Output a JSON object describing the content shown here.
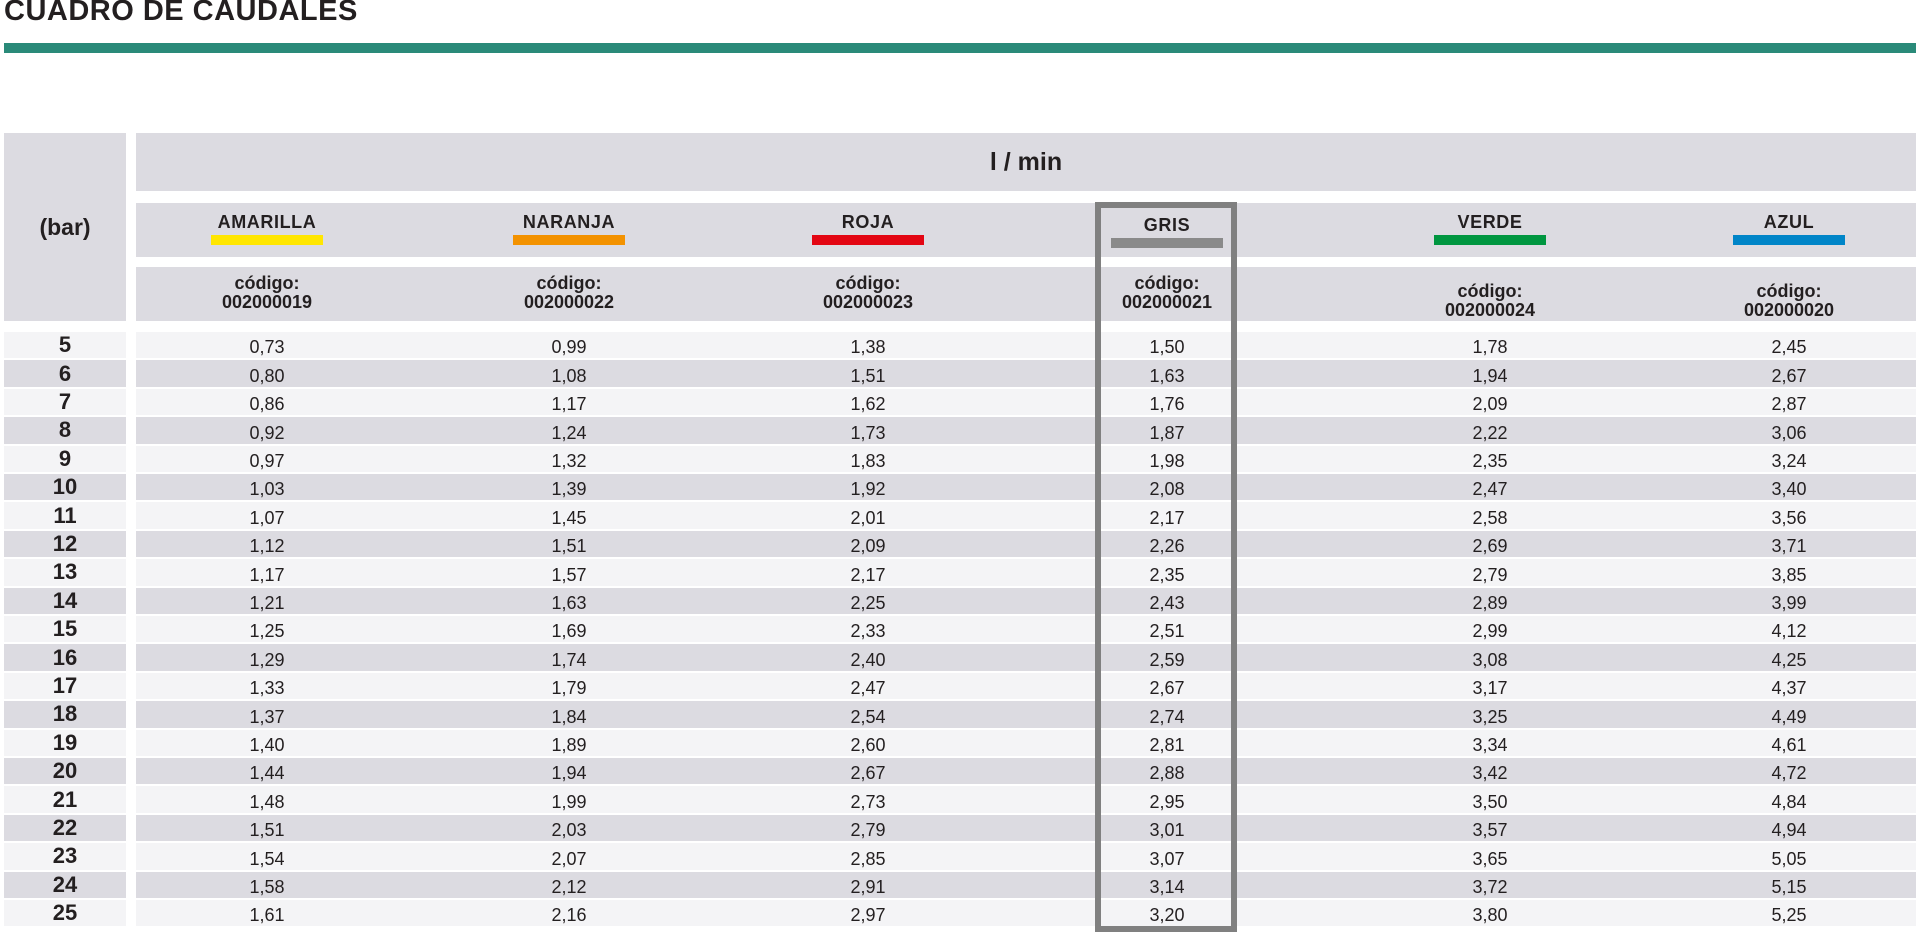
{
  "page": {
    "title": "CUADRO DE CAUDALES",
    "accent_color": "#2a8a79"
  },
  "table": {
    "pressure_header": "(bar)",
    "flow_header": "l / min",
    "highlighted_column": "GRIS",
    "columns": [
      {
        "name": "AMARILLA",
        "code_label": "código:",
        "code": "002000019",
        "color": "#ffe600"
      },
      {
        "name": "NARANJA",
        "code_label": "código:",
        "code": "002000022",
        "color": "#f39200"
      },
      {
        "name": "ROJA",
        "code_label": "código:",
        "code": "002000023",
        "color": "#e30613"
      },
      {
        "name": "GRIS",
        "code_label": "código:",
        "code": "002000021",
        "color": "#8a8a8a"
      },
      {
        "name": "VERDE",
        "code_label": "código:",
        "code": "002000024",
        "color": "#009640"
      },
      {
        "name": "AZUL",
        "code_label": "código:",
        "code": "002000020",
        "color": "#0085c8"
      }
    ],
    "rows": [
      {
        "bar": "5",
        "values": [
          "0,73",
          "0,99",
          "1,38",
          "1,50",
          "1,78",
          "2,45"
        ]
      },
      {
        "bar": "6",
        "values": [
          "0,80",
          "1,08",
          "1,51",
          "1,63",
          "1,94",
          "2,67"
        ]
      },
      {
        "bar": "7",
        "values": [
          "0,86",
          "1,17",
          "1,62",
          "1,76",
          "2,09",
          "2,87"
        ]
      },
      {
        "bar": "8",
        "values": [
          "0,92",
          "1,24",
          "1,73",
          "1,87",
          "2,22",
          "3,06"
        ]
      },
      {
        "bar": "9",
        "values": [
          "0,97",
          "1,32",
          "1,83",
          "1,98",
          "2,35",
          "3,24"
        ]
      },
      {
        "bar": "10",
        "values": [
          "1,03",
          "1,39",
          "1,92",
          "2,08",
          "2,47",
          "3,40"
        ]
      },
      {
        "bar": "11",
        "values": [
          "1,07",
          "1,45",
          "2,01",
          "2,17",
          "2,58",
          "3,56"
        ]
      },
      {
        "bar": "12",
        "values": [
          "1,12",
          "1,51",
          "2,09",
          "2,26",
          "2,69",
          "3,71"
        ]
      },
      {
        "bar": "13",
        "values": [
          "1,17",
          "1,57",
          "2,17",
          "2,35",
          "2,79",
          "3,85"
        ]
      },
      {
        "bar": "14",
        "values": [
          "1,21",
          "1,63",
          "2,25",
          "2,43",
          "2,89",
          "3,99"
        ]
      },
      {
        "bar": "15",
        "values": [
          "1,25",
          "1,69",
          "2,33",
          "2,51",
          "2,99",
          "4,12"
        ]
      },
      {
        "bar": "16",
        "values": [
          "1,29",
          "1,74",
          "2,40",
          "2,59",
          "3,08",
          "4,25"
        ]
      },
      {
        "bar": "17",
        "values": [
          "1,33",
          "1,79",
          "2,47",
          "2,67",
          "3,17",
          "4,37"
        ]
      },
      {
        "bar": "18",
        "values": [
          "1,37",
          "1,84",
          "2,54",
          "2,74",
          "3,25",
          "4,49"
        ]
      },
      {
        "bar": "19",
        "values": [
          "1,40",
          "1,89",
          "2,60",
          "2,81",
          "3,34",
          "4,61"
        ]
      },
      {
        "bar": "20",
        "values": [
          "1,44",
          "1,94",
          "2,67",
          "2,88",
          "3,42",
          "4,72"
        ]
      },
      {
        "bar": "21",
        "values": [
          "1,48",
          "1,99",
          "2,73",
          "2,95",
          "3,50",
          "4,84"
        ]
      },
      {
        "bar": "22",
        "values": [
          "1,51",
          "2,03",
          "2,79",
          "3,01",
          "3,57",
          "4,94"
        ]
      },
      {
        "bar": "23",
        "values": [
          "1,54",
          "2,07",
          "2,85",
          "3,07",
          "3,65",
          "5,05"
        ]
      },
      {
        "bar": "24",
        "values": [
          "1,58",
          "2,12",
          "2,91",
          "3,14",
          "3,72",
          "5,15"
        ]
      },
      {
        "bar": "25",
        "values": [
          "1,61",
          "2,16",
          "2,97",
          "3,20",
          "3,80",
          "5,25"
        ]
      }
    ]
  }
}
